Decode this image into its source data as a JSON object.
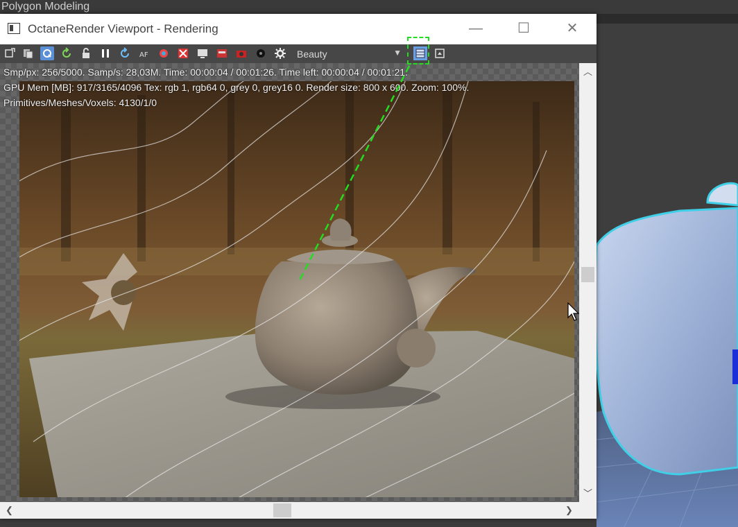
{
  "background": {
    "title": "Polygon Modeling"
  },
  "window": {
    "title": "OctaneRender Viewport - Rendering",
    "controls": {
      "minimize": "—",
      "maximize": "☐",
      "close": "✕"
    }
  },
  "toolbar": {
    "buttons": [
      {
        "icon": "send-scene-icon"
      },
      {
        "icon": "copy-image-icon"
      },
      {
        "icon": "realtime-icon",
        "active": true
      },
      {
        "icon": "restart-icon"
      },
      {
        "icon": "lock-icon"
      },
      {
        "icon": "pause-icon"
      },
      {
        "icon": "refresh-icon"
      },
      {
        "icon": "autofocus-icon"
      },
      {
        "icon": "color-picker-icon"
      },
      {
        "icon": "region-render-icon"
      },
      {
        "icon": "display-icon"
      },
      {
        "icon": "film-region-icon"
      },
      {
        "icon": "camera-icon"
      },
      {
        "icon": "gpu-icon"
      },
      {
        "icon": "settings-icon"
      }
    ],
    "pass_selector": {
      "value": "Beauty",
      "arrow": "▼"
    },
    "after_buttons": [
      {
        "icon": "channel-view-icon",
        "highlight": true
      },
      {
        "icon": "save-image-icon"
      }
    ]
  },
  "stats": {
    "line1": "Smp/px: 256/5000.  Samp/s: 28,03M.  Time: 00:00:04 / 00:01:26.  Time left: 00:00:04 / 00:01:21.",
    "line2": "GPU Mem [MB]: 917/3165/4096  Tex: rgb 1, rgb64 0, grey 0, grey16 0.  Render size: 800 x 600.  Zoom: 100%.",
    "line3": "Primitives/Meshes/Voxels: 4130/1/0"
  },
  "scrollbars": {
    "up": "︿",
    "down": "﹀",
    "left": "❮",
    "right": "❯"
  },
  "colors": {
    "annotation": "#22dd22",
    "toolbar_bg": "#474747",
    "active_button": "#5b8fd6",
    "teapot_selection": "#3fd0e8"
  }
}
